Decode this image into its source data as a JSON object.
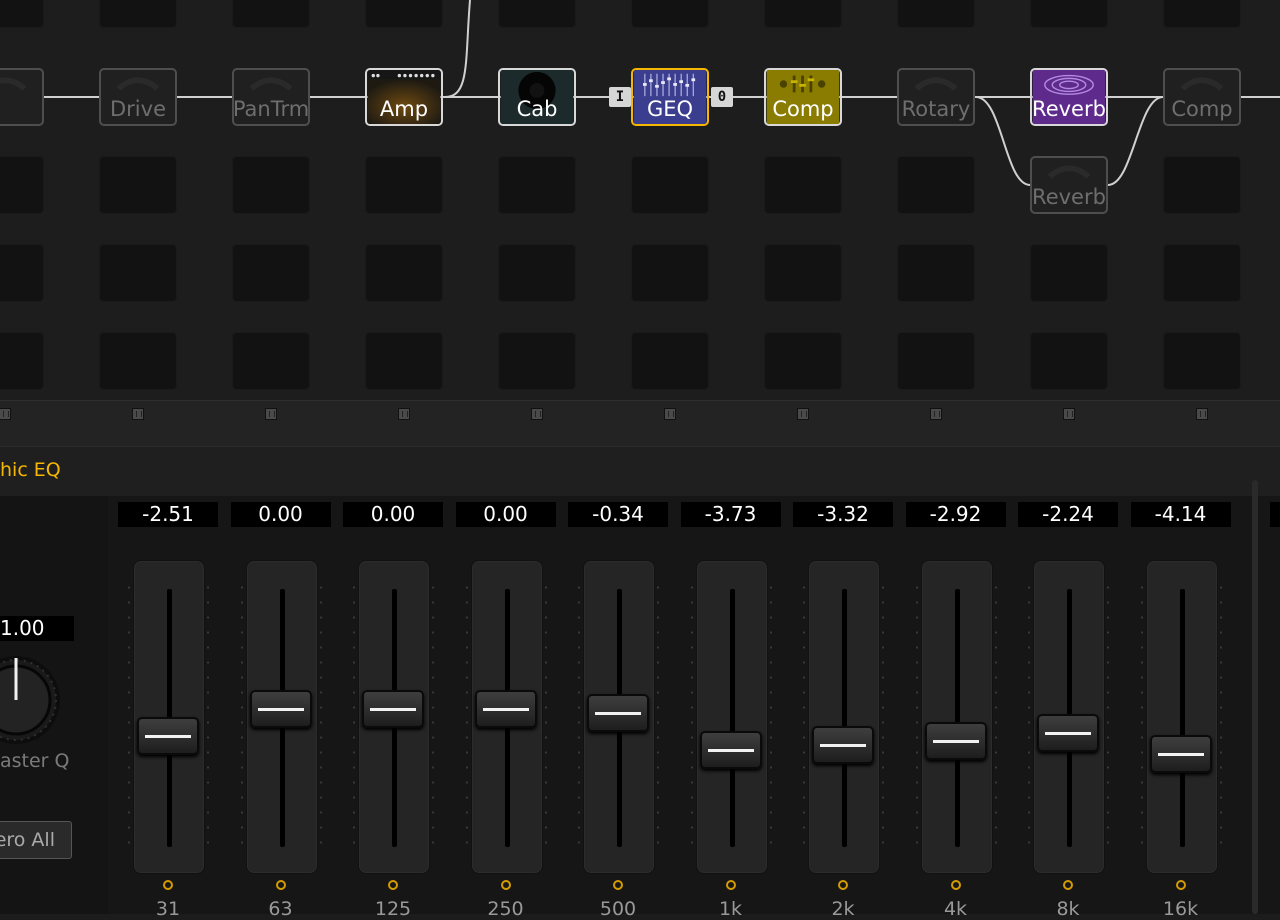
{
  "signal_chain": {
    "blocks": [
      {
        "label": "",
        "state": "ghost"
      },
      {
        "label": "Drive",
        "state": "ghost"
      },
      {
        "label": "PanTrm",
        "state": "ghost"
      },
      {
        "label": "Amp",
        "state": "active",
        "color": "#3a2a0a"
      },
      {
        "label": "Cab",
        "state": "active",
        "color": "#1d2a2c"
      },
      {
        "label": "GEQ",
        "state": "selected",
        "color": "#3b3d8f"
      },
      {
        "label": "Comp",
        "state": "active",
        "color": "#8a7c00"
      },
      {
        "label": "Rotary",
        "state": "ghost"
      },
      {
        "label": "Reverb",
        "state": "active",
        "color": "#5e2a8c"
      },
      {
        "label": "Comp",
        "state": "ghost"
      },
      {
        "label": "Reverb",
        "state": "ghost"
      }
    ],
    "input_port": "I",
    "output_port": "0",
    "selected_border_color": "#f5b700"
  },
  "panel": {
    "title": "hic EQ",
    "master_q_value": "1.00",
    "master_q_label": "aster Q",
    "zero_all_label": "ero All",
    "accent_color": "#f5b700"
  },
  "eq": {
    "range_db": [
      -12,
      12
    ],
    "bands": [
      {
        "freq": "31",
        "value": "-2.51",
        "db": -2.51
      },
      {
        "freq": "63",
        "value": "0.00",
        "db": 0.0
      },
      {
        "freq": "125",
        "value": "0.00",
        "db": 0.0
      },
      {
        "freq": "250",
        "value": "0.00",
        "db": 0.0
      },
      {
        "freq": "500",
        "value": "-0.34",
        "db": -0.34
      },
      {
        "freq": "1k",
        "value": "-3.73",
        "db": -3.73
      },
      {
        "freq": "2k",
        "value": "-3.32",
        "db": -3.32
      },
      {
        "freq": "4k",
        "value": "-2.92",
        "db": -2.92
      },
      {
        "freq": "8k",
        "value": "-2.24",
        "db": -2.24
      },
      {
        "freq": "16k",
        "value": "-4.14",
        "db": -4.14
      }
    ]
  }
}
